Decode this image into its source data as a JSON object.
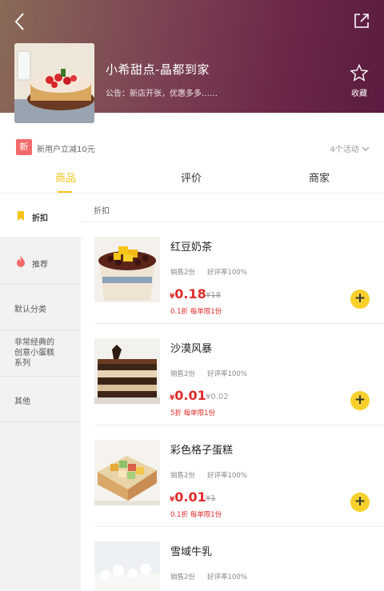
{
  "shop": {
    "name": "小希甜点-晶都到家",
    "notice": "公告：新店开张，优惠多多……",
    "favorite_label": "收藏"
  },
  "promo": {
    "badge": "新",
    "text": "新用户立减10元",
    "activities": "4个活动"
  },
  "tabs": [
    {
      "label": "商品",
      "active": true
    },
    {
      "label": "评价",
      "active": false
    },
    {
      "label": "商家",
      "active": false
    }
  ],
  "sidebar": {
    "items": [
      {
        "label": "折扣",
        "icon": "discount-tag-icon",
        "active": true
      },
      {
        "label": "推荐",
        "icon": "flame-icon",
        "active": false
      },
      {
        "label": "默认分类",
        "active": false
      },
      {
        "label": "非常经典的创意小蛋糕系列",
        "lines": [
          "非常经典的",
          "创意小蛋糕",
          "系列"
        ],
        "active": false
      },
      {
        "label": "其他",
        "active": false
      }
    ]
  },
  "section_title": "折扣",
  "products": [
    {
      "name": "红豆奶茶",
      "sales": "销售2份",
      "rating": "好评率100%",
      "currency": "¥",
      "price": "0.18",
      "original_price": "¥18",
      "discount": "0.1折 每单限1份"
    },
    {
      "name": "沙漠风暴",
      "sales": "销售2份",
      "rating": "好评率100%",
      "currency": "¥",
      "price": "0.01",
      "original_price": "¥0.02",
      "discount": "5折 每单限1份"
    },
    {
      "name": "彩色格子蛋糕",
      "sales": "销售2份",
      "rating": "好评率100%",
      "currency": "¥",
      "price": "0.01",
      "original_price": "¥1",
      "discount": "0.1折 每单限1份"
    },
    {
      "name": "雪域牛乳",
      "sales": "销售2份",
      "rating": "好评率100%"
    }
  ],
  "colors": {
    "accent": "#f5c518",
    "price": "#e02b2b",
    "add_button": "#f7d02c",
    "promo_badge": "#f26b6b"
  }
}
